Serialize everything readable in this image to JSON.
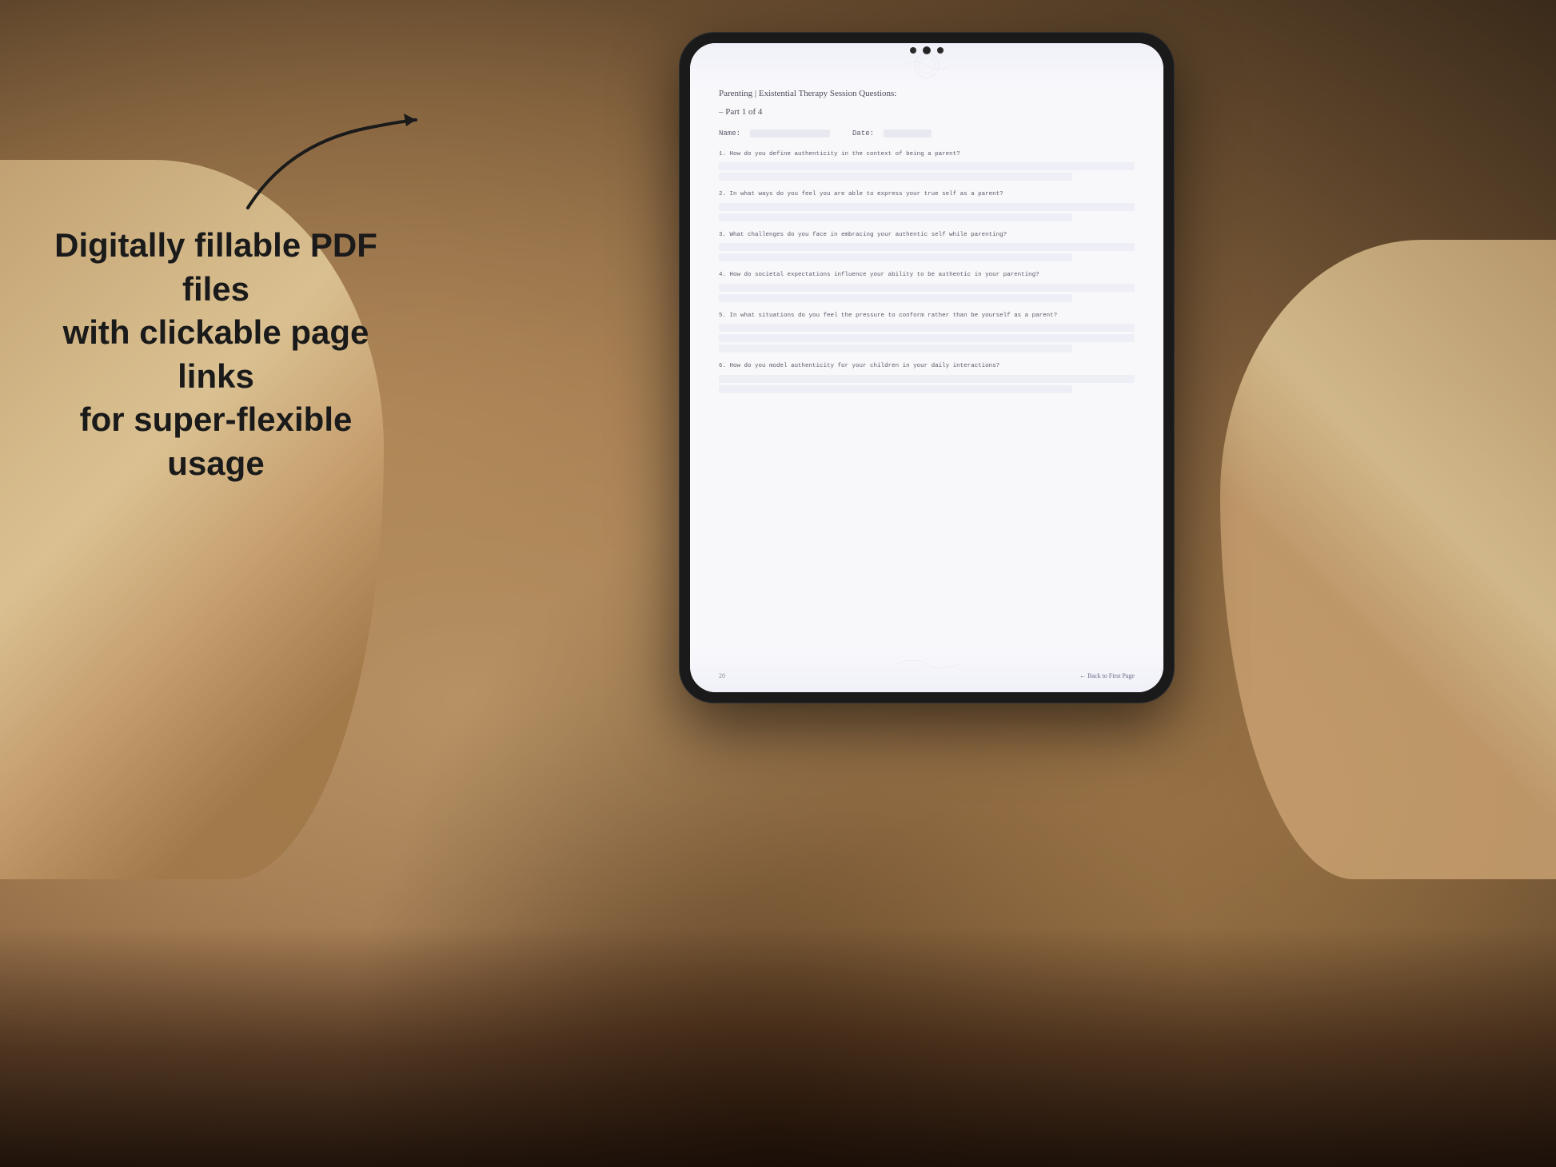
{
  "background": {
    "color": "#c4a882"
  },
  "left_text": {
    "line1": "Digitally fillable PDF files",
    "line2": "with clickable page links",
    "line3": "for super-flexible usage"
  },
  "arrow": {
    "description": "curved arrow pointing right toward tablet"
  },
  "tablet": {
    "pdf": {
      "title": "Parenting | Existential Therapy Session Questions:",
      "subtitle": "– Part 1 of 4",
      "name_label": "Name:",
      "date_label": "Date:",
      "questions": [
        {
          "number": "1.",
          "text": "How do you define authenticity in the context of being a parent?"
        },
        {
          "number": "2.",
          "text": "In what ways do you feel you are able to express your true self as a parent?"
        },
        {
          "number": "3.",
          "text": "What challenges do you face in embracing your authentic self while parenting?"
        },
        {
          "number": "4.",
          "text": "How do societal expectations influence your ability to be authentic in your parenting?"
        },
        {
          "number": "5.",
          "text": "In what situations do you feel the pressure to conform rather than be yourself as a parent?"
        },
        {
          "number": "6.",
          "text": "How do you model authenticity for your children in your daily interactions?"
        }
      ],
      "footer": {
        "page_number": "20",
        "back_link": "← Back to First Page"
      }
    }
  }
}
